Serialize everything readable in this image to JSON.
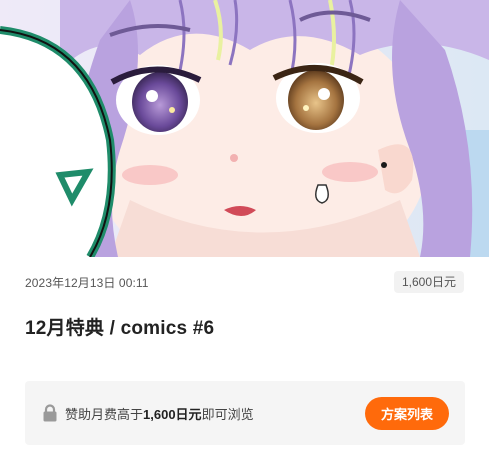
{
  "post": {
    "date": "2023年12月13日 00:11",
    "price_badge": "1,600日元",
    "title": "12月特典 / comics #6"
  },
  "locked": {
    "text_prefix": "赞助月费高于",
    "amount": "1,600日元",
    "text_suffix": "即可浏览",
    "plans_button": "方案列表"
  },
  "colors": {
    "accent": "#ff6a0b",
    "box_bg": "#f5f5f5",
    "badge_bg": "#f2f2f2"
  },
  "icons": {
    "lock": "lock-icon"
  }
}
